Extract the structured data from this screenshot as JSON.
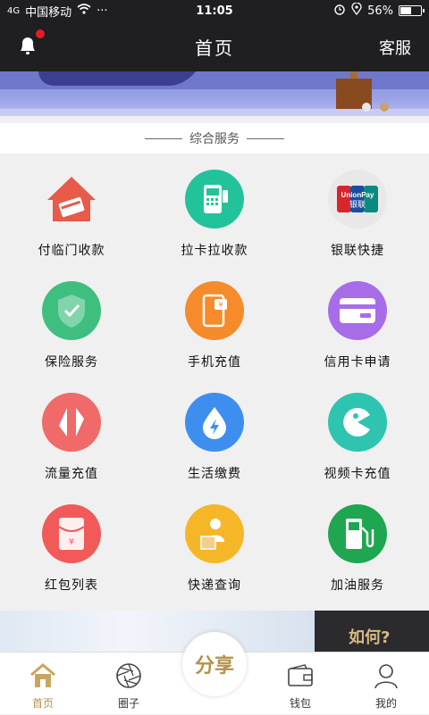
{
  "status_bar": {
    "carrier": "中国移动",
    "signal_label": "4G",
    "more": "···",
    "time": "11:05",
    "battery_text": "56%",
    "battery_level": 0.56
  },
  "nav": {
    "title": "首页",
    "service_link": "客服",
    "has_notification": true
  },
  "banner": {
    "slides": 2,
    "active_slide": 0
  },
  "section": {
    "title": "综合服务"
  },
  "services": [
    {
      "label": "付临门收款",
      "color": "#e85a4a",
      "icon": "house-card-icon"
    },
    {
      "label": "拉卡拉收款",
      "color": "#22c39b",
      "icon": "pos-terminal-icon"
    },
    {
      "label": "银联快捷",
      "color": "#e8e8e8",
      "icon": "unionpay-icon"
    },
    {
      "label": "保险服务",
      "color": "#3fbf7f",
      "icon": "shield-check-icon"
    },
    {
      "label": "手机充值",
      "color": "#f58b2b",
      "icon": "phone-yen-icon"
    },
    {
      "label": "信用卡申请",
      "color": "#a76de8",
      "icon": "credit-card-icon"
    },
    {
      "label": "流量充值",
      "color": "#f06a6a",
      "icon": "arrows-up-down-icon"
    },
    {
      "label": "生活缴费",
      "color": "#3e8ef0",
      "icon": "water-drop-bolt-icon"
    },
    {
      "label": "视频卡充值",
      "color": "#2ec4b0",
      "icon": "video-pacman-icon"
    },
    {
      "label": "红包列表",
      "color": "#f25a5a",
      "icon": "red-envelope-icon"
    },
    {
      "label": "快递查询",
      "color": "#f5b728",
      "icon": "courier-box-icon"
    },
    {
      "label": "加油服务",
      "color": "#1fa651",
      "icon": "gas-pump-icon"
    }
  ],
  "unionpay_text": {
    "top": "UnionPay",
    "bottom": "银联"
  },
  "lower_banner": {
    "text": "如何?"
  },
  "tabs": [
    {
      "label": "首页",
      "icon": "home-icon",
      "active": true
    },
    {
      "label": "圈子",
      "icon": "aperture-icon",
      "active": false
    },
    {
      "label": "钱包",
      "icon": "wallet-icon",
      "active": false
    },
    {
      "label": "我的",
      "icon": "user-icon",
      "active": false
    }
  ],
  "share_button": {
    "label": "分享"
  }
}
